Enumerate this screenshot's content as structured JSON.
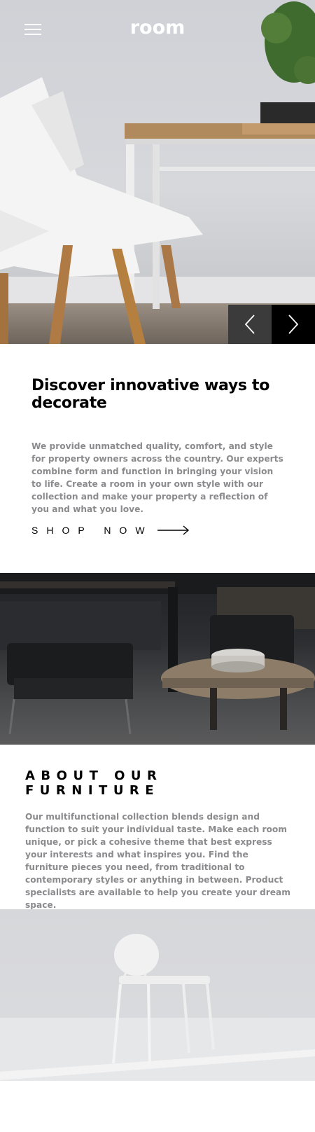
{
  "header": {
    "logo": "room",
    "menu_icon": "hamburger-icon"
  },
  "hero": {
    "image_desc": "white-chair-and-wood-table",
    "prev_icon": "chevron-left-icon",
    "next_icon": "chevron-right-icon"
  },
  "intro": {
    "title": "Discover innovative ways to decorate",
    "body": "We provide unmatched quality, comfort, and style for property owners across the country. Our experts combine form and function in bringing your vision to life. Create a room in your own style with our collection and make your property a reflection of you and what you love.",
    "cta_label": "SHOP NOW",
    "cta_icon": "arrow-right-icon"
  },
  "about": {
    "title": "ABOUT OUR FURNITURE",
    "body": "Our multifunctional collection blends design and function to suit your individual taste. Make each room unique, or pick a cohesive theme that best express your interests and what inspires you. Find the furniture pieces you need, from traditional to contemporary styles or anything in between. Product specialists are available to help you create your dream space."
  },
  "colors": {
    "text_primary": "#000000",
    "text_muted": "#8b8b8e",
    "control_dark": "#3b3b3b",
    "control_black": "#000000",
    "background": "#ffffff"
  }
}
